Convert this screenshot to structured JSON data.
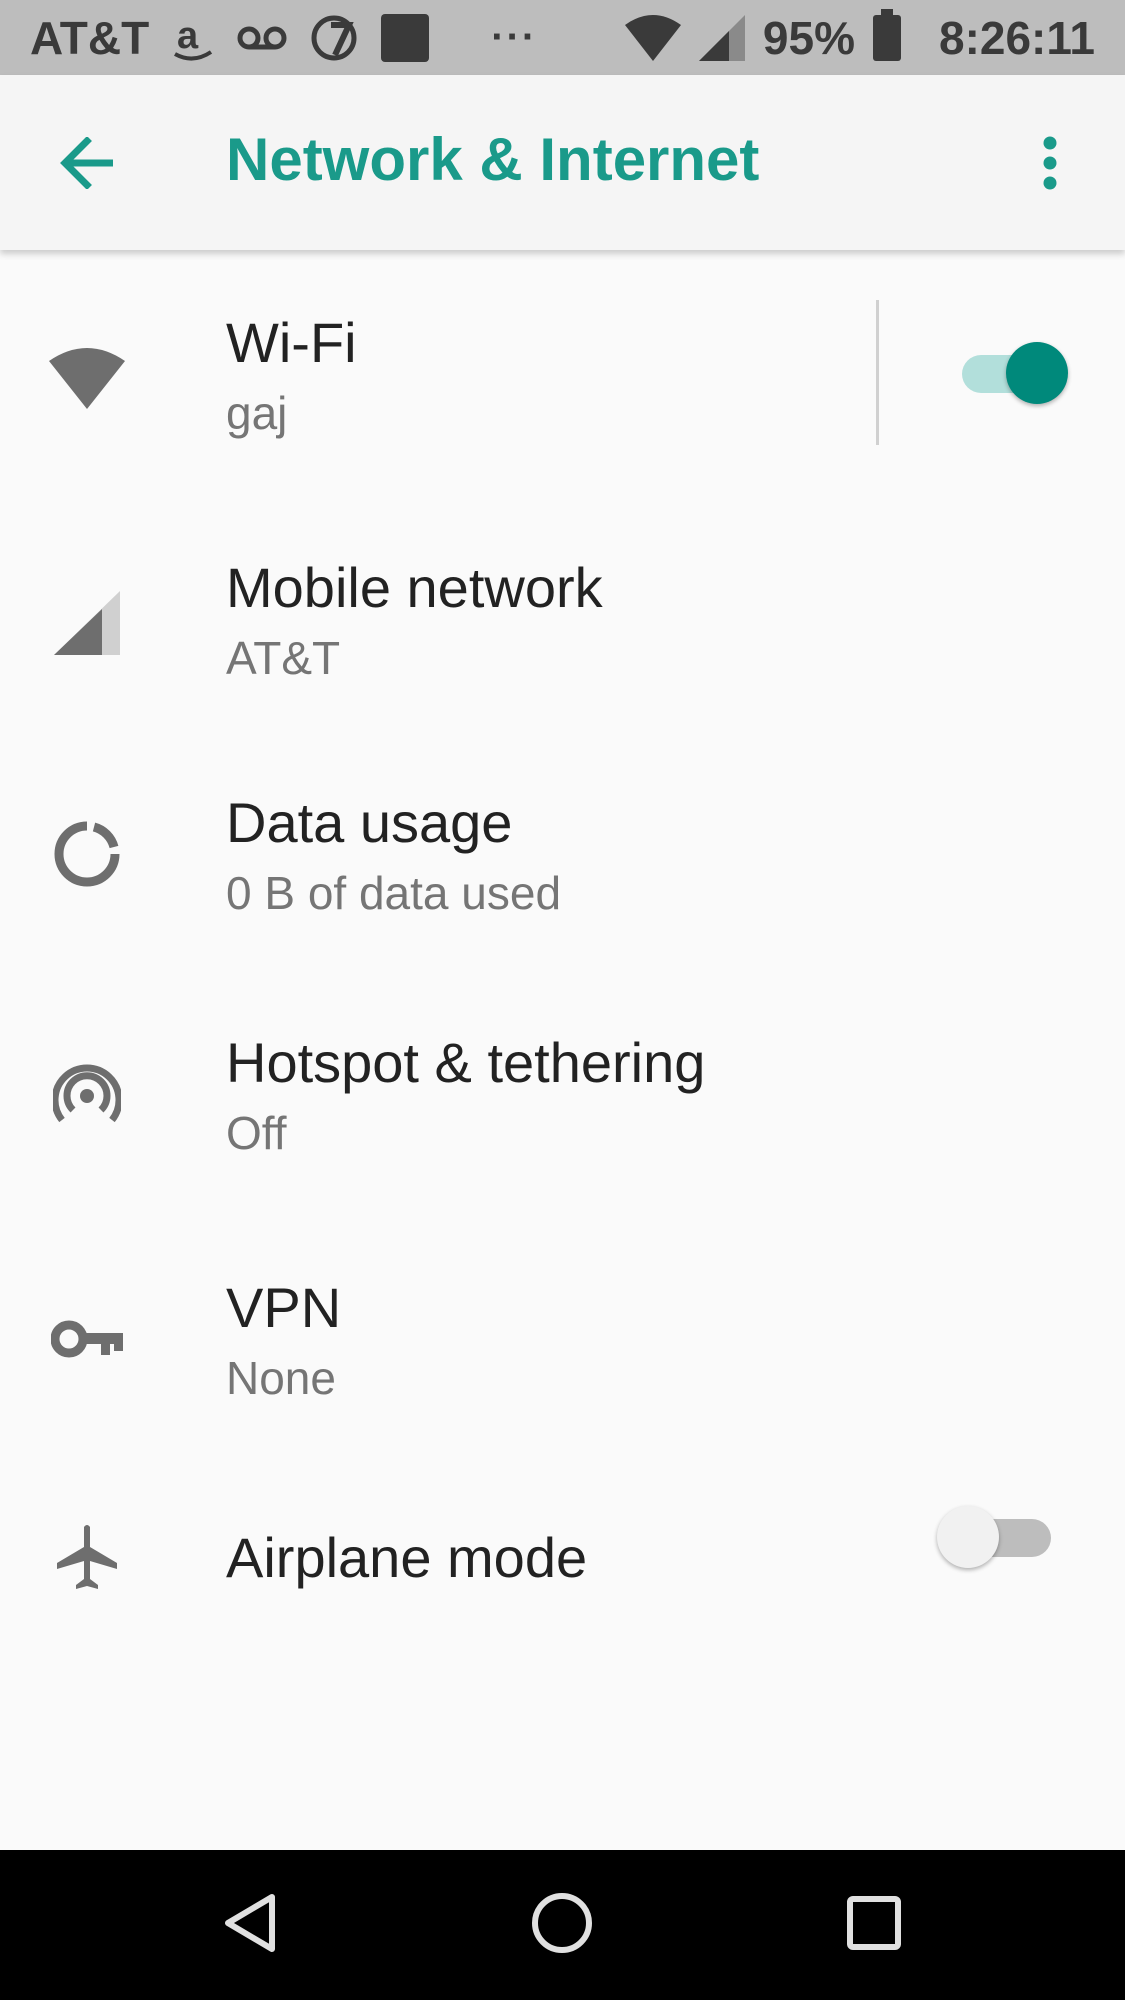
{
  "status_bar": {
    "carrier": "AT&T",
    "overflow": "···",
    "battery_percent": "95%",
    "time": "8:26:11",
    "icons": [
      "amazon-icon",
      "voicemail-icon",
      "abc7-icon",
      "app-square-icon",
      "wifi-icon",
      "signal-icon",
      "battery-icon"
    ]
  },
  "app_bar": {
    "title": "Network & Internet",
    "back_icon": "arrow-back-icon",
    "menu_icon": "more-vert-icon"
  },
  "settings": [
    {
      "key": "wifi",
      "title": "Wi-Fi",
      "subtitle": "gaj",
      "icon": "wifi-icon",
      "toggle": "on"
    },
    {
      "key": "mobile",
      "title": "Mobile network",
      "subtitle": "AT&T",
      "icon": "signal-icon"
    },
    {
      "key": "data",
      "title": "Data usage",
      "subtitle": "0 B of data used",
      "icon": "data-usage-icon"
    },
    {
      "key": "hotspot",
      "title": "Hotspot & tethering",
      "subtitle": "Off",
      "icon": "hotspot-icon"
    },
    {
      "key": "vpn",
      "title": "VPN",
      "subtitle": "None",
      "icon": "vpn-key-icon"
    },
    {
      "key": "airplane",
      "title": "Airplane mode",
      "icon": "airplane-icon",
      "toggle": "off"
    }
  ],
  "nav_bar": {
    "icons": [
      "back-triangle-icon",
      "home-circle-icon",
      "recents-square-icon"
    ]
  },
  "colors": {
    "accent": "#1a9a8a",
    "toggle_on": "#00897b",
    "icon_gray": "#757575"
  }
}
